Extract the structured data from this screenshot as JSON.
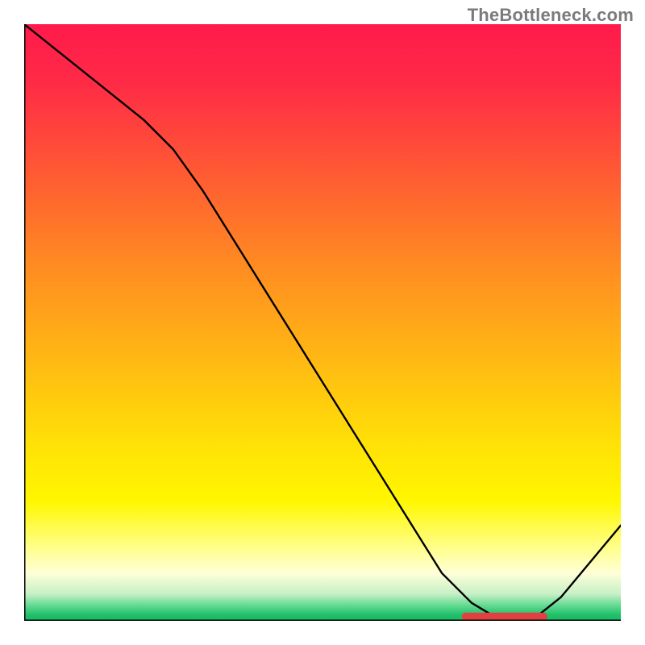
{
  "watermark": "TheBottleneck.com",
  "chart_data": {
    "type": "line",
    "title": "",
    "xlabel": "",
    "ylabel": "",
    "xlim": [
      0,
      100
    ],
    "ylim": [
      0,
      100
    ],
    "x": [
      0,
      5,
      10,
      15,
      20,
      25,
      30,
      35,
      40,
      45,
      50,
      55,
      60,
      65,
      70,
      75,
      80,
      85,
      90,
      95,
      100
    ],
    "y": [
      100,
      96,
      92,
      88,
      84,
      79,
      72,
      64,
      56,
      48,
      40,
      32,
      24,
      16,
      8,
      3,
      0,
      0,
      4,
      10,
      16
    ],
    "marker": {
      "x_start": 74,
      "x_end": 87,
      "y": 0.7
    },
    "gradient_stops": [
      {
        "offset": 0.0,
        "color": "#ff1a4b"
      },
      {
        "offset": 0.1,
        "color": "#ff2b46"
      },
      {
        "offset": 0.25,
        "color": "#ff5a33"
      },
      {
        "offset": 0.4,
        "color": "#ff8a22"
      },
      {
        "offset": 0.55,
        "color": "#ffb514"
      },
      {
        "offset": 0.7,
        "color": "#ffe008"
      },
      {
        "offset": 0.8,
        "color": "#fff700"
      },
      {
        "offset": 0.88,
        "color": "#ffff8f"
      },
      {
        "offset": 0.92,
        "color": "#ffffd8"
      },
      {
        "offset": 0.955,
        "color": "#c6f0c6"
      },
      {
        "offset": 0.975,
        "color": "#5fd98f"
      },
      {
        "offset": 0.99,
        "color": "#21c06b"
      },
      {
        "offset": 1.0,
        "color": "#18b862"
      }
    ],
    "axis_color": "#000000"
  }
}
